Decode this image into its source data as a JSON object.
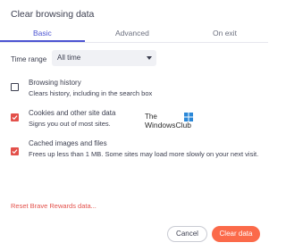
{
  "dialog": {
    "title": "Clear browsing data"
  },
  "tabs": [
    {
      "label": "Basic",
      "active": true
    },
    {
      "label": "Advanced",
      "active": false
    },
    {
      "label": "On exit",
      "active": false
    }
  ],
  "time_range": {
    "label": "Time range",
    "value": "All time"
  },
  "options": [
    {
      "title": "Browsing history",
      "description": "Clears history, including in the search box",
      "checked": false
    },
    {
      "title": "Cookies and other site data",
      "description": "Signs you out of most sites.",
      "checked": true
    },
    {
      "title": "Cached images and files",
      "description": "Frees up less than 1 MB. Some sites may load more slowly on your next visit.",
      "checked": true
    }
  ],
  "watermark": {
    "line1": "The",
    "line2": "WindowsClub"
  },
  "reset_link": "Reset Brave Rewards data...",
  "buttons": {
    "cancel": "Cancel",
    "clear": "Clear data"
  },
  "colors": {
    "accent": "#4c54d2",
    "checkbox": "#e3504a",
    "primary_button": "#fb6a4a"
  }
}
